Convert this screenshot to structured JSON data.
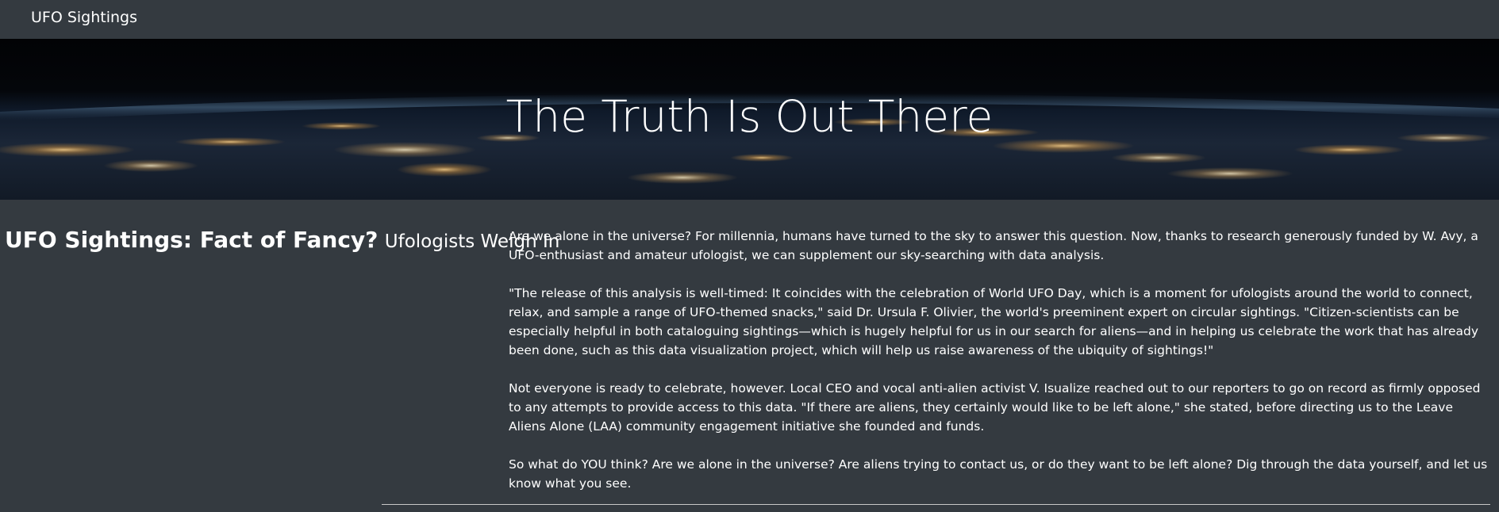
{
  "navbar": {
    "brand": "UFO Sightings"
  },
  "hero": {
    "title": "The Truth Is Out There"
  },
  "sidebar": {
    "heading_main": "UFO Sightings: Fact of Fancy?",
    "heading_sub": "Ufologists Weigh In"
  },
  "article": {
    "paragraphs": [
      "Are we alone in the universe? For millennia, humans have turned to the sky to answer this question. Now, thanks to research generously funded by W. Avy, a UFO-enthusiast and amateur ufologist, we can supplement our sky-searching with data analysis.",
      "\"The release of this analysis is well-timed: It coincides with the celebration of World UFO Day, which is a moment for ufologists around the world to connect, relax, and sample a range of UFO-themed snacks,\" said Dr. Ursula F. Olivier, the world's preeminent expert on circular sightings. \"Citizen-scientists can be especially helpful in both cataloguing sightings—which is hugely helpful for us in our search for aliens—and in helping us celebrate the work that has already been done, such as this data visualization project, which will help us raise awareness of the ubiquity of sightings!\"",
      "Not everyone is ready to celebrate, however. Local CEO and vocal anti-alien activist V. Isualize reached out to our reporters to go on record as firmly opposed to any attempts to provide access to this data. \"If there are aliens, they certainly would like to be left alone,\" she stated, before directing us to the Leave Aliens Alone (LAA) community engagement initiative she founded and funds.",
      "So what do YOU think? Are we alone in the universe? Are aliens trying to contact us, or do they want to be left alone? Dig through the data yourself, and let us know what you see."
    ]
  },
  "colors": {
    "background": "#343a40",
    "text": "#ffffff",
    "divider": "#c8c8c8"
  }
}
